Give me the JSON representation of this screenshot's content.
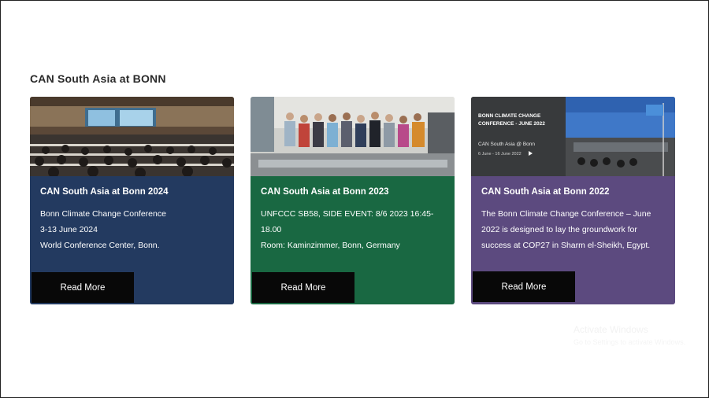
{
  "section": {
    "title": "CAN South Asia at BONN"
  },
  "cards": [
    {
      "title": "CAN South Asia at Bonn 2024",
      "lines": [
        "Bonn Climate Change Conference",
        "3-13 June 2024",
        "World Conference Center, Bonn."
      ],
      "button": "Read More",
      "color": "#233a60"
    },
    {
      "title": "CAN South Asia at Bonn 2023",
      "lines": [
        "UNFCCC SB58, SIDE EVENT: 8/6 2023 16:45-",
        "18.00",
        "Room: Kaminzimmer, Bonn, Germany"
      ],
      "button": "Read More",
      "color": "#196842"
    },
    {
      "title": "CAN South Asia at Bonn 2022",
      "lines": [
        "The Bonn Climate Change Conference – June",
        "2022 is designed to lay the groundwork for",
        "success at COP27 in Sharm el-Sheikh, Egypt."
      ],
      "button": "Read More",
      "color": "#5c4a7f"
    }
  ],
  "banner": {
    "line1": "BONN CLIMATE CHANGE",
    "line2": "CONFERENCE - JUNE 2022",
    "line3": "CAN South Asia @ Bonn",
    "line4": "6 June - 16 June 2022"
  },
  "watermark": {
    "line1": "Activate Windows",
    "line2": "Go to Settings to activate Windows."
  }
}
